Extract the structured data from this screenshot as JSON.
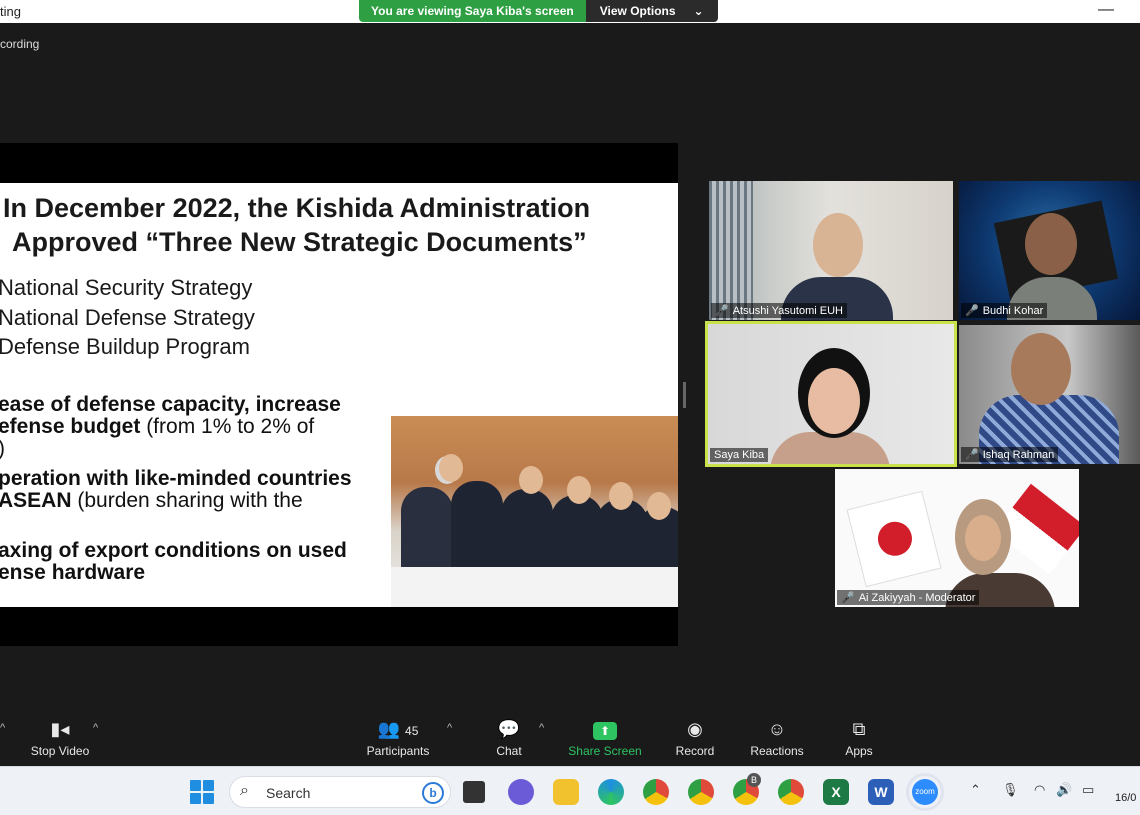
{
  "window": {
    "title": "ting",
    "minimize": "—",
    "recording_text": "cording"
  },
  "banner": {
    "viewing": "You are viewing Saya Kiba's screen",
    "view_options": "View Options",
    "chevron": "⌄"
  },
  "slide": {
    "heading_line1": "In December 2022, the Kishida Administration",
    "heading_line2": "Approved “Three New Strategic Documents”",
    "documents": [
      "National Security Strategy",
      "National Defense Strategy",
      "Defense Buildup Program"
    ],
    "points": [
      {
        "bold1": "ease of defense capacity, increase",
        "bold2": "efense budget",
        "normal2": " (from 1% to 2% of",
        "normal3": ")"
      },
      {
        "bold1": "peration with like-minded countries",
        "bold2": " ASEAN",
        "normal2": " (burden sharing with the"
      },
      {
        "bold1": "axing of export conditions on used",
        "bold2": "ense hardware"
      }
    ]
  },
  "participants": [
    {
      "name": "Atsushi Yasutomi EUH",
      "muted": true
    },
    {
      "name": "Budhi Kohar",
      "muted": true
    },
    {
      "name": "Saya Kiba",
      "muted": false,
      "active_speaker": true
    },
    {
      "name": "Ishaq Rahman",
      "muted": true
    },
    {
      "name": "Ai Zakiyyah - Moderator",
      "muted": true
    }
  ],
  "toolbar": {
    "stop_video": "Stop Video",
    "participants_label": "Participants",
    "participants_count": "45",
    "chat": "Chat",
    "share_screen": "Share Screen",
    "record": "Record",
    "reactions": "Reactions",
    "apps": "Apps",
    "caret": "^",
    "colors": {
      "share_accent": "#2ec462",
      "active_speaker": "#c7e24a",
      "mute": "#e5484d"
    }
  },
  "taskbar": {
    "search_placeholder": "Search",
    "date": "16/0",
    "apps": [
      "file-explorer",
      "zoom-meetings",
      "edge",
      "chrome",
      "chrome-profile",
      "chrome-profile-b",
      "chrome-2",
      "excel",
      "word",
      "zoom"
    ],
    "profile_badge": "B",
    "zoom_label": "zoom",
    "excel_letter": "X",
    "word_letter": "W"
  }
}
